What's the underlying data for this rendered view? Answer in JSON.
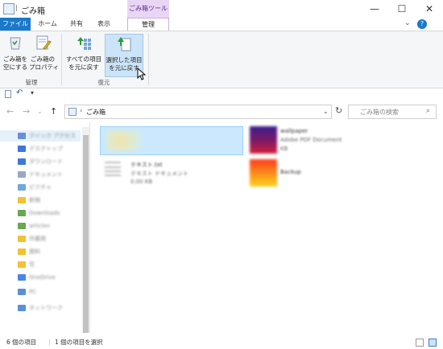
{
  "window": {
    "title": "ごみ箱",
    "context_tab_group": "ごみ箱ツール",
    "minimize": "—",
    "maximize": "☐",
    "close": "✕"
  },
  "ribbon_tabs": {
    "file": "ファイル",
    "home": "ホーム",
    "share": "共有",
    "view": "表示",
    "manage": "管理"
  },
  "ribbon": {
    "empty_bin": "ごみ箱を\n空にする",
    "bin_properties": "ごみ箱の\nプロパティ",
    "restore_all": "すべての項目\nを元に戻す",
    "restore_selected": "選択した項目\nを元に戻す",
    "group_manage": "管理",
    "group_restore": "復元"
  },
  "address": {
    "path_sep": "›",
    "location": "ごみ箱",
    "search_placeholder": "ごみ箱の検索"
  },
  "nav_pane": {
    "items": [
      {
        "label": "クイック アクセス",
        "color": "#6a8fd8",
        "selected": true
      },
      {
        "label": "デスクトップ",
        "color": "#3c78d8"
      },
      {
        "label": "ダウンロード",
        "color": "#3c78d8"
      },
      {
        "label": "ドキュメント",
        "color": "#9aa8c2"
      },
      {
        "label": "ピクチャ",
        "color": "#6fa8dc"
      },
      {
        "label": "新規",
        "color": "#f1c232"
      },
      {
        "label": "Downloads",
        "color": "#6aa84f"
      },
      {
        "label": "articles",
        "color": "#6aa84f"
      },
      {
        "label": "作業用",
        "color": "#f1c232"
      },
      {
        "label": "資料",
        "color": "#f1c232"
      },
      {
        "label": "写",
        "color": "#f1c232"
      },
      {
        "label": "OneDrive",
        "color": "#4a86e8"
      },
      {
        "label": "PC",
        "color": "#5b8fd6"
      },
      {
        "label": "ネットワーク",
        "color": "#5b8fd6"
      }
    ]
  },
  "files": [
    {
      "name": "",
      "meta1": "",
      "meta2": ""
    },
    {
      "name": "wallpaper",
      "meta1": "Adobe PDF Document",
      "meta2": "KB"
    },
    {
      "name": "テキスト.txt",
      "meta1": "テキスト ドキュメント",
      "meta2": "0.00 KB"
    },
    {
      "name": "Backup",
      "meta1": "",
      "meta2": ""
    }
  ],
  "status": {
    "count": "6 個の項目",
    "selected": "1 個の項目を選択"
  }
}
